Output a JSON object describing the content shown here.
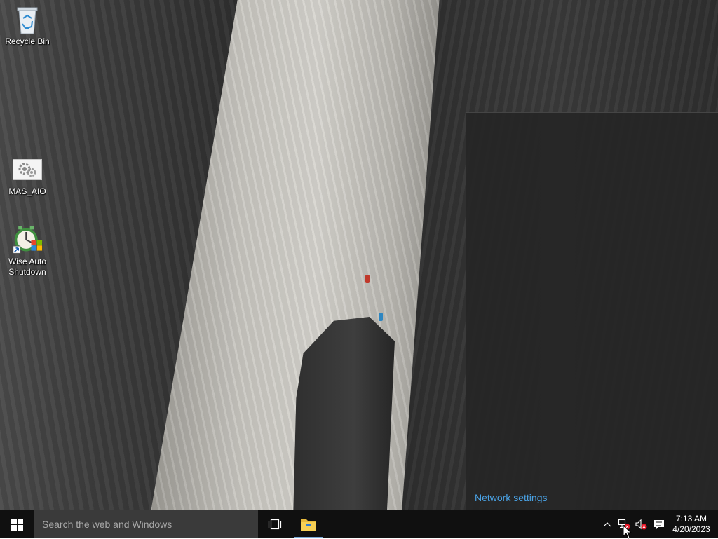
{
  "desktop": {
    "icons": [
      {
        "label": "Recycle Bin",
        "icon": "recycle-bin-icon"
      },
      {
        "label": "MAS_AIO",
        "icon": "settings-gears-icon"
      },
      {
        "label": "Wise Auto Shutdown",
        "icon": "wise-auto-shutdown-icon"
      }
    ]
  },
  "flyout": {
    "network_settings_label": "Network settings",
    "link_color": "#4aa3e6"
  },
  "taskbar": {
    "start_icon": "windows-logo-icon",
    "search_placeholder": "Search the web and Windows",
    "task_view_icon": "task-view-icon",
    "pinned": [
      {
        "name": "File Explorer",
        "icon": "file-explorer-icon"
      }
    ],
    "tray": {
      "overflow_icon": "chevron-up-icon",
      "network_icon": "network-disconnected-icon",
      "volume_icon": "volume-muted-icon",
      "action_center_icon": "action-center-icon"
    },
    "clock": {
      "time": "7:13 AM",
      "date": "4/20/2023"
    }
  }
}
